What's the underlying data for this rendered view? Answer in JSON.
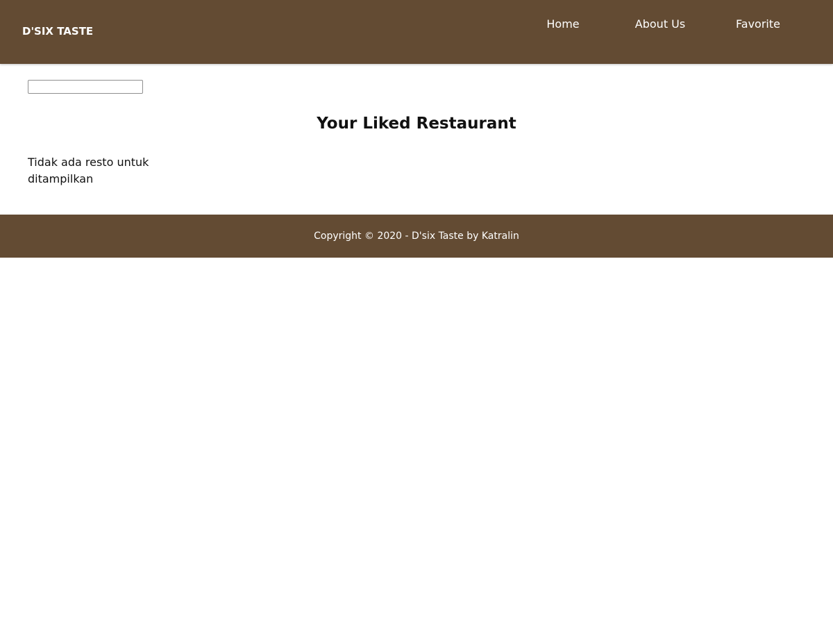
{
  "header": {
    "brand": "D'SIX TASTE",
    "nav": [
      {
        "label": "Home"
      },
      {
        "label": "About Us"
      },
      {
        "label": "Favorite"
      }
    ]
  },
  "search": {
    "value": "",
    "placeholder": ""
  },
  "main": {
    "title": "Your Liked Restaurant",
    "empty_message": "Tidak ada resto untuk ditampilkan"
  },
  "footer": {
    "text": "Copyright © 2020 - D'six Taste by Katralin"
  },
  "colors": {
    "brand_brown": "#634b33",
    "text_light": "#ffffff",
    "text_dark": "#111111"
  }
}
